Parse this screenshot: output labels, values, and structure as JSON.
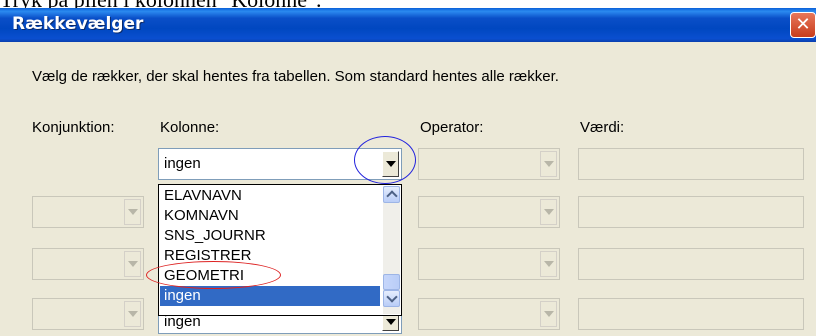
{
  "caption": "Tryk på pilen i kolonnen \"Kolonne\".",
  "window": {
    "title": "Rækkevælger",
    "close_symbol": "✕"
  },
  "instruction": "Vælg de rækker, der skal hentes fra tabellen. Som standard hentes alle rækker.",
  "columns": {
    "conjunction": "Konjunktion:",
    "column": "Kolonne:",
    "operator": "Operator:",
    "value": "Værdi:"
  },
  "rows": [
    {
      "column_value": "ingen"
    },
    {
      "column_value": ""
    },
    {
      "column_value": ""
    },
    {
      "column_value": "ingen"
    }
  ],
  "dropdown": {
    "options": [
      "ELAVNAVN",
      "KOMNAVN",
      "SNS_JOURNR",
      "REGISTRER",
      "GEOMETRI",
      "ingen"
    ],
    "selected": "ingen"
  },
  "annotations": {
    "arrow_highlight_color": "#2222dd",
    "option_highlight_color": "#dd2222"
  }
}
